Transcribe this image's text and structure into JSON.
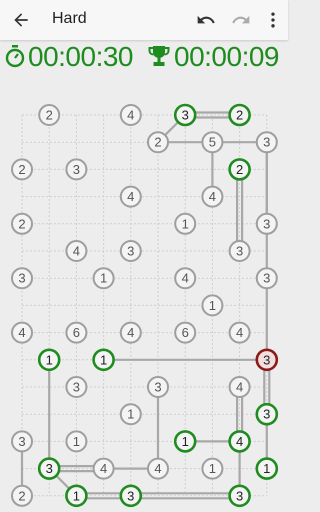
{
  "toolbar": {
    "title": "Hard",
    "back_icon": "arrow-back-icon",
    "undo_icon": "undo-icon",
    "redo_icon": "redo-icon",
    "menu_icon": "more-vert-icon"
  },
  "timers": {
    "elapsed": "00:00:30",
    "best": "00:00:09",
    "elapsed_icon": "stopwatch-icon",
    "best_icon": "trophy-icon"
  },
  "colors": {
    "accent": "#1f8c1f",
    "error": "#8b1a1a",
    "node": "#9e9e9e",
    "bridge": "#a8a8a8"
  },
  "puzzle": {
    "cols": 10,
    "rows": 15,
    "islands": [
      {
        "id": "a1",
        "col": 1,
        "row": 0,
        "value": "2",
        "state": "normal"
      },
      {
        "id": "a2",
        "col": 4,
        "row": 0,
        "value": "4",
        "state": "normal"
      },
      {
        "id": "a3",
        "col": 6,
        "row": 0,
        "value": "3",
        "state": "done"
      },
      {
        "id": "a4",
        "col": 8,
        "row": 0,
        "value": "2",
        "state": "done"
      },
      {
        "id": "b1",
        "col": 5,
        "row": 1,
        "value": "2",
        "state": "normal"
      },
      {
        "id": "b2",
        "col": 7,
        "row": 1,
        "value": "5",
        "state": "normal"
      },
      {
        "id": "b3",
        "col": 9,
        "row": 1,
        "value": "3",
        "state": "normal"
      },
      {
        "id": "c1",
        "col": 0,
        "row": 2,
        "value": "2",
        "state": "normal"
      },
      {
        "id": "c2",
        "col": 2,
        "row": 2,
        "value": "3",
        "state": "normal"
      },
      {
        "id": "c3",
        "col": 8,
        "row": 2,
        "value": "2",
        "state": "done"
      },
      {
        "id": "d1",
        "col": 4,
        "row": 3,
        "value": "4",
        "state": "normal"
      },
      {
        "id": "d2",
        "col": 7,
        "row": 3,
        "value": "4",
        "state": "normal"
      },
      {
        "id": "e1",
        "col": 0,
        "row": 4,
        "value": "2",
        "state": "normal"
      },
      {
        "id": "e2",
        "col": 6,
        "row": 4,
        "value": "1",
        "state": "normal"
      },
      {
        "id": "e3",
        "col": 9,
        "row": 4,
        "value": "3",
        "state": "normal"
      },
      {
        "id": "f1",
        "col": 2,
        "row": 5,
        "value": "4",
        "state": "normal"
      },
      {
        "id": "f2",
        "col": 4,
        "row": 5,
        "value": "3",
        "state": "normal"
      },
      {
        "id": "f3",
        "col": 8,
        "row": 5,
        "value": "3",
        "state": "normal"
      },
      {
        "id": "g1",
        "col": 0,
        "row": 6,
        "value": "3",
        "state": "normal"
      },
      {
        "id": "g2",
        "col": 3,
        "row": 6,
        "value": "1",
        "state": "normal"
      },
      {
        "id": "g3",
        "col": 6,
        "row": 6,
        "value": "4",
        "state": "normal"
      },
      {
        "id": "g4",
        "col": 9,
        "row": 6,
        "value": "3",
        "state": "normal"
      },
      {
        "id": "h1",
        "col": 7,
        "row": 7,
        "value": "1",
        "state": "normal"
      },
      {
        "id": "i1",
        "col": 0,
        "row": 8,
        "value": "4",
        "state": "normal"
      },
      {
        "id": "i2",
        "col": 2,
        "row": 8,
        "value": "6",
        "state": "normal"
      },
      {
        "id": "i3",
        "col": 4,
        "row": 8,
        "value": "4",
        "state": "normal"
      },
      {
        "id": "i4",
        "col": 6,
        "row": 8,
        "value": "6",
        "state": "normal"
      },
      {
        "id": "i5",
        "col": 8,
        "row": 8,
        "value": "4",
        "state": "normal"
      },
      {
        "id": "j1",
        "col": 1,
        "row": 9,
        "value": "1",
        "state": "done"
      },
      {
        "id": "j2",
        "col": 3,
        "row": 9,
        "value": "1",
        "state": "done"
      },
      {
        "id": "j3",
        "col": 9,
        "row": 9,
        "value": "3",
        "state": "error"
      },
      {
        "id": "k1",
        "col": 2,
        "row": 10,
        "value": "3",
        "state": "normal"
      },
      {
        "id": "k2",
        "col": 5,
        "row": 10,
        "value": "3",
        "state": "normal"
      },
      {
        "id": "k3",
        "col": 8,
        "row": 10,
        "value": "4",
        "state": "normal"
      },
      {
        "id": "l1",
        "col": 4,
        "row": 11,
        "value": "1",
        "state": "normal"
      },
      {
        "id": "l2",
        "col": 9,
        "row": 11,
        "value": "3",
        "state": "done"
      },
      {
        "id": "m1",
        "col": 0,
        "row": 12,
        "value": "3",
        "state": "normal"
      },
      {
        "id": "m2",
        "col": 2,
        "row": 12,
        "value": "1",
        "state": "normal"
      },
      {
        "id": "m3",
        "col": 6,
        "row": 12,
        "value": "1",
        "state": "done"
      },
      {
        "id": "m4",
        "col": 8,
        "row": 12,
        "value": "4",
        "state": "done"
      },
      {
        "id": "n1",
        "col": 1,
        "row": 13,
        "value": "3",
        "state": "done"
      },
      {
        "id": "n2",
        "col": 3,
        "row": 13,
        "value": "4",
        "state": "normal"
      },
      {
        "id": "n3",
        "col": 5,
        "row": 13,
        "value": "4",
        "state": "normal"
      },
      {
        "id": "n4",
        "col": 7,
        "row": 13,
        "value": "1",
        "state": "normal"
      },
      {
        "id": "n5",
        "col": 9,
        "row": 13,
        "value": "1",
        "state": "done"
      },
      {
        "id": "o1",
        "col": 0,
        "row": 14,
        "value": "2",
        "state": "normal"
      },
      {
        "id": "o2",
        "col": 2,
        "row": 14,
        "value": "1",
        "state": "done"
      },
      {
        "id": "o3",
        "col": 4,
        "row": 14,
        "value": "3",
        "state": "done"
      },
      {
        "id": "o4",
        "col": 8,
        "row": 14,
        "value": "3",
        "state": "done"
      }
    ],
    "bridges": [
      {
        "from": "a3",
        "to": "a4",
        "count": 2
      },
      {
        "from": "a3",
        "to": "b1",
        "count": 1
      },
      {
        "from": "b1",
        "to": "b2",
        "count": 1
      },
      {
        "from": "b2",
        "to": "b3",
        "count": 1
      },
      {
        "from": "b2",
        "to": "d2",
        "count": 1
      },
      {
        "from": "b3",
        "to": "e3",
        "count": 1
      },
      {
        "from": "c3",
        "to": "f3",
        "count": 2
      },
      {
        "from": "b3",
        "to": "j3",
        "count": 1
      },
      {
        "from": "j1",
        "to": "n1",
        "count": 1
      },
      {
        "from": "j2",
        "to": "j3",
        "count": 1
      },
      {
        "from": "j3",
        "to": "l2",
        "count": 2
      },
      {
        "from": "k3",
        "to": "m4",
        "count": 2
      },
      {
        "from": "k2",
        "to": "n3",
        "count": 1
      },
      {
        "from": "l2",
        "to": "n5",
        "count": 1
      },
      {
        "from": "m3",
        "to": "m4",
        "count": 1
      },
      {
        "from": "m4",
        "to": "o4",
        "count": 1
      },
      {
        "from": "n1",
        "to": "n2",
        "count": 2
      },
      {
        "from": "n2",
        "to": "n3",
        "count": 1
      },
      {
        "from": "m1",
        "to": "o1",
        "count": 1
      },
      {
        "from": "o2",
        "to": "o3",
        "count": 2
      },
      {
        "from": "o3",
        "to": "o4",
        "count": 2
      },
      {
        "from": "o2",
        "to": "n1",
        "count": 1
      }
    ]
  }
}
